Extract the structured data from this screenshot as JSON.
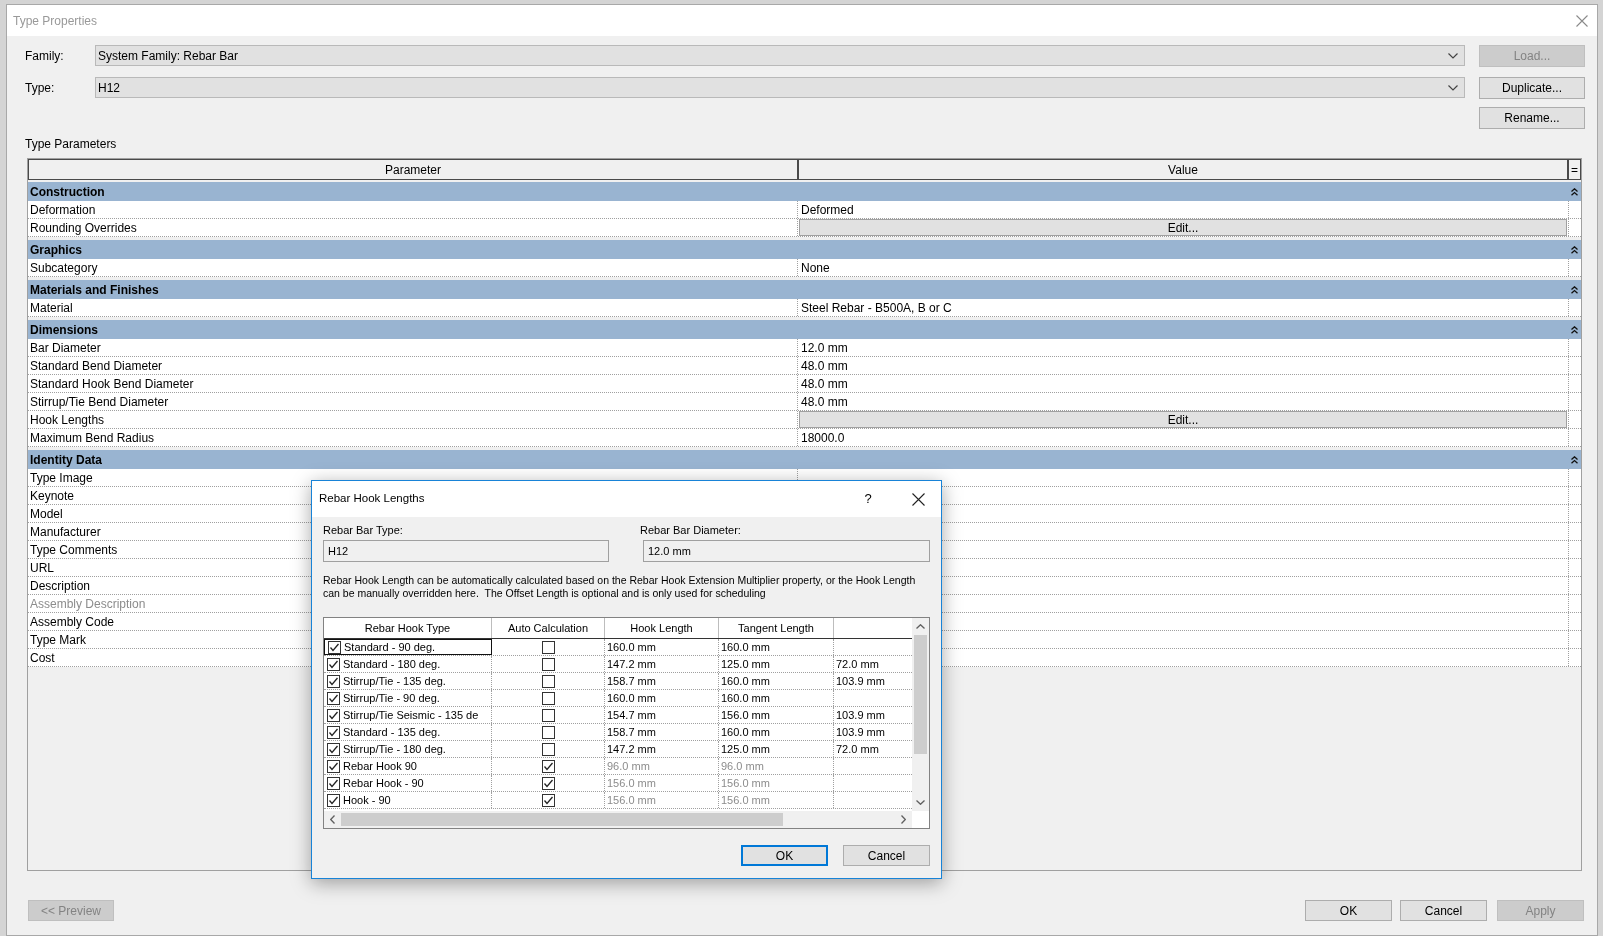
{
  "window": {
    "title": "Type Properties"
  },
  "family": {
    "label": "Family:",
    "value": "System Family: Rebar Bar"
  },
  "type": {
    "label": "Type:",
    "value": "H12"
  },
  "side_buttons": [
    {
      "label": "Load...",
      "disabled": true
    },
    {
      "label": "Duplicate...",
      "disabled": false
    },
    {
      "label": "Rename...",
      "disabled": false
    }
  ],
  "type_parameters": {
    "title": "Type Parameters",
    "columns": [
      "Parameter",
      "Value",
      "="
    ],
    "groups": [
      {
        "name": "Construction",
        "expanded": true,
        "rows": [
          {
            "kind": "text",
            "parameter": "Deformation",
            "value": "Deformed",
            "disabled": false
          },
          {
            "kind": "button",
            "parameter": "Rounding Overrides",
            "value": "Edit...",
            "disabled": false
          }
        ]
      },
      {
        "name": "Graphics",
        "expanded": true,
        "rows": [
          {
            "kind": "text",
            "parameter": "Subcategory",
            "value": "None",
            "disabled": false
          }
        ]
      },
      {
        "name": "Materials and Finishes",
        "expanded": true,
        "rows": [
          {
            "kind": "text",
            "parameter": "Material",
            "value": "Steel Rebar - B500A, B or C",
            "disabled": false
          }
        ]
      },
      {
        "name": "Dimensions",
        "expanded": true,
        "rows": [
          {
            "kind": "text",
            "parameter": "Bar Diameter",
            "value": "12.0 mm",
            "disabled": false
          },
          {
            "kind": "text",
            "parameter": "Standard Bend Diameter",
            "value": "48.0 mm",
            "disabled": false
          },
          {
            "kind": "text",
            "parameter": "Standard Hook Bend Diameter",
            "value": "48.0 mm",
            "disabled": false
          },
          {
            "kind": "text",
            "parameter": "Stirrup/Tie Bend Diameter",
            "value": "48.0 mm",
            "disabled": false
          },
          {
            "kind": "button",
            "parameter": "Hook Lengths",
            "value": "Edit...",
            "disabled": false
          },
          {
            "kind": "text",
            "parameter": "Maximum Bend Radius",
            "value": "18000.0",
            "disabled": false
          }
        ]
      },
      {
        "name": "Identity Data",
        "expanded": true,
        "rows": [
          {
            "kind": "text",
            "parameter": "Type Image",
            "disabled": false
          },
          {
            "kind": "text",
            "parameter": "Keynote",
            "disabled": false
          },
          {
            "kind": "text",
            "parameter": "Model",
            "disabled": false
          },
          {
            "kind": "text",
            "parameter": "Manufacturer",
            "disabled": false
          },
          {
            "kind": "text",
            "parameter": "Type Comments",
            "disabled": false
          },
          {
            "kind": "text",
            "parameter": "URL",
            "disabled": false
          },
          {
            "kind": "text",
            "parameter": "Description",
            "disabled": false
          },
          {
            "kind": "text",
            "parameter": "Assembly Description",
            "disabled": true
          },
          {
            "kind": "text",
            "parameter": "Assembly Code",
            "disabled": false
          },
          {
            "kind": "text",
            "parameter": "Type Mark",
            "disabled": false
          },
          {
            "kind": "text",
            "parameter": "Cost",
            "disabled": false
          }
        ]
      }
    ]
  },
  "footer_buttons": [
    {
      "label": "<< Preview",
      "disabled": true
    },
    {
      "label": "OK",
      "disabled": false
    },
    {
      "label": "Cancel",
      "disabled": false
    },
    {
      "label": "Apply",
      "disabled": true
    }
  ],
  "hook_dialog": {
    "title": "Rebar Hook Lengths",
    "help": "?",
    "bar_type": {
      "label": "Rebar Bar Type:",
      "value": "H12"
    },
    "bar_diameter": {
      "label": "Rebar Bar Diameter:",
      "value": "12.0 mm"
    },
    "description": "Rebar Hook Length can be automatically calculated based on the Rebar Hook Extension Multiplier property, or the Hook Length can be manually overridden here.  The Offset Length is optional and is only used for scheduling",
    "columns": [
      "Rebar Hook Type",
      "Auto Calculation",
      "Hook Length",
      "Tangent Length"
    ],
    "rows": [
      {
        "name": "Standard - 90 deg.",
        "enabled": true,
        "selected": true,
        "auto_calculation": false,
        "hook_length": "160.0 mm",
        "tangent_length": "160.0 mm"
      },
      {
        "name": "Standard - 180 deg.",
        "enabled": true,
        "selected": false,
        "auto_calculation": false,
        "hook_length": "147.2 mm",
        "tangent_length": "125.0 mm",
        "column_5": "72.0 mm"
      },
      {
        "name": "Stirrup/Tie - 135 deg.",
        "enabled": true,
        "selected": false,
        "auto_calculation": false,
        "hook_length": "158.7 mm",
        "tangent_length": "160.0 mm",
        "column_5": "103.9 mm"
      },
      {
        "name": "Stirrup/Tie - 90 deg.",
        "enabled": true,
        "selected": false,
        "auto_calculation": false,
        "hook_length": "160.0 mm",
        "tangent_length": "160.0 mm"
      },
      {
        "name": "Stirrup/Tie Seismic - 135 de",
        "enabled": true,
        "selected": false,
        "auto_calculation": false,
        "hook_length": "154.7 mm",
        "tangent_length": "156.0 mm",
        "column_5": "103.9 mm"
      },
      {
        "name": "Standard - 135 deg.",
        "enabled": true,
        "selected": false,
        "auto_calculation": false,
        "hook_length": "158.7 mm",
        "tangent_length": "160.0 mm",
        "column_5": "103.9 mm"
      },
      {
        "name": "Stirrup/Tie - 180 deg.",
        "enabled": true,
        "selected": false,
        "auto_calculation": false,
        "hook_length": "147.2 mm",
        "tangent_length": "125.0 mm",
        "column_5": "72.0 mm"
      },
      {
        "name": "Rebar Hook 90",
        "enabled": true,
        "selected": false,
        "auto_calculation": true,
        "hook_length": "96.0 mm",
        "tangent_length": "96.0 mm"
      },
      {
        "name": "Rebar Hook - 90",
        "enabled": true,
        "selected": false,
        "auto_calculation": true,
        "hook_length": "156.0 mm",
        "tangent_length": "156.0 mm"
      },
      {
        "name": "Hook - 90",
        "enabled": true,
        "selected": false,
        "auto_calculation": true,
        "hook_length": "156.0 mm",
        "tangent_length": "156.0 mm"
      }
    ],
    "buttons": [
      {
        "label": "OK",
        "default": true
      },
      {
        "label": "Cancel",
        "default": false
      }
    ]
  }
}
